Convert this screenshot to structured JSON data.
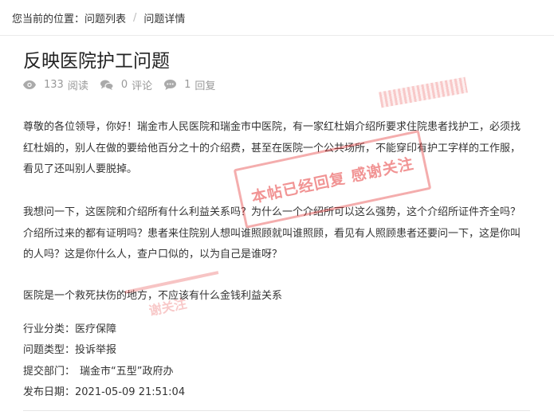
{
  "breadcrumb": {
    "prefix": "您当前的位置：",
    "items": [
      "问题列表",
      "问题详情"
    ],
    "separator": "/"
  },
  "question": {
    "title": "反映医院护工问题",
    "stats": {
      "views": "133",
      "views_label": "阅读",
      "comments": "0",
      "comments_label": "评论",
      "replies": "1",
      "replies_label": "回复"
    },
    "paragraphs": [
      "尊敬的各位领导，你好！瑞金市人民医院和瑞金市中医院，有一家红杜娟介绍所要求住院患者找护工，必须找红杜娟的，别人在做的要给他百分之十的介绍费，甚至在医院一个公共场所，不能穿印有护工字样的工作服，看见了还叫别人要脱掉。",
      "我想问一下，这医院和介绍所有什么利益关系吗？为什么一个介绍所可以这么强势，这个介绍所证件齐全吗？介绍所过来的都有证明吗？患者来住院别人想叫谁照顾就叫谁照顾，看见有人照顾患者还要问一下，这是你叫的人吗？这是你什么人，查户口似的，以为自己是谁呀？",
      "医院是一个救死扶伤的地方，不应该有什么金钱利益关系"
    ],
    "info": {
      "category_label": "行业分类：",
      "category": "医疗保障",
      "type_label": "问题类型：",
      "type": "投诉举报",
      "department_label": "提交部门：",
      "department": "瑞金市“五型”政府办",
      "date_label": "发布日期：",
      "date": "2021-05-09 21:51:04"
    },
    "stamp_text": "本帖已经回复 感谢关注",
    "stamp_partial_text": "谢关注"
  },
  "colors": {
    "text": "#333333",
    "muted": "#999999",
    "stamp": "#e53c3c"
  },
  "icons": {
    "views": "eye-icon",
    "comments": "comment-bubbles-icon",
    "replies": "reply-bubble-icon"
  }
}
